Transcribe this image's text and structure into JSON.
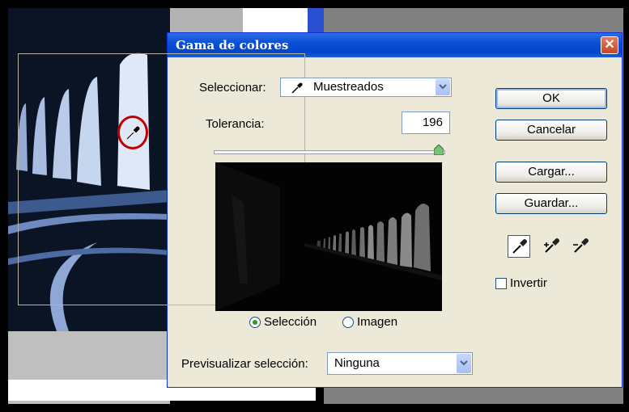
{
  "dialog": {
    "title": "Gama de colores",
    "close_symbol": "✕",
    "select_label": "Seleccionar:",
    "select_value": "Muestreados",
    "tolerance_label": "Tolerancia:",
    "tolerance_value": "196",
    "tolerance_slider_fraction": 0.98,
    "radio_selection": "Selección",
    "radio_image": "Imagen",
    "radio_selected": "Selección",
    "preview_label": "Previsualizar selección:",
    "preview_value": "Ninguna",
    "invert_label": "Invertir",
    "invert_checked": false
  },
  "buttons": {
    "ok": "OK",
    "cancel": "Cancelar",
    "load": "Cargar...",
    "save": "Guardar..."
  },
  "tools": {
    "eyedropper": "eyedropper-icon",
    "eyedropper_plus": "eyedropper-plus-icon",
    "eyedropper_minus": "eyedropper-minus-icon"
  },
  "colors": {
    "title_bar": "#0a4fd6",
    "close_button": "#c9442a",
    "dialog_bg": "#ece9d8",
    "highlight_circle": "#c00000"
  }
}
